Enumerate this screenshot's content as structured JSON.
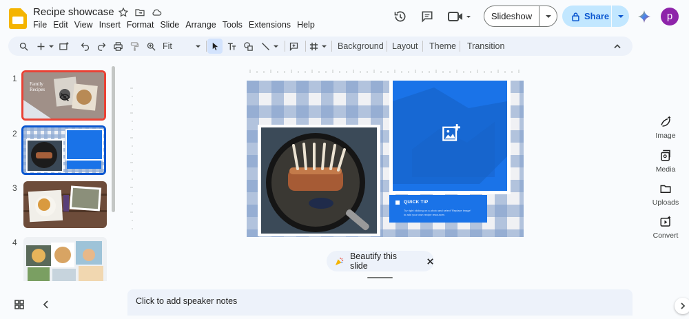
{
  "app": {
    "doc_title": "Recipe showcase",
    "user_initial": "p"
  },
  "menu": [
    "File",
    "Edit",
    "View",
    "Insert",
    "Format",
    "Slide",
    "Arrange",
    "Tools",
    "Extensions",
    "Help"
  ],
  "header": {
    "slideshow_label": "Slideshow",
    "share_label": "Share"
  },
  "toolbar": {
    "zoom_value": "Fit",
    "background_label": "Background",
    "layout_label": "Layout",
    "theme_label": "Theme",
    "transition_label": "Transition"
  },
  "slides": [
    {
      "number": "1",
      "title_line1": "Family",
      "title_line2": "Recipes"
    },
    {
      "number": "2"
    },
    {
      "number": "3"
    },
    {
      "number": "4"
    }
  ],
  "current_slide": {
    "tip_title": "QUICK TIP",
    "tip_body_line1": "Try right clicking on a photo and select 'Replace image'",
    "tip_body_line2": "to add your own recipe resources"
  },
  "beautify": {
    "label": "Beautify this slide"
  },
  "notes": {
    "placeholder": "Click to add speaker notes"
  },
  "side_panel": [
    {
      "label": "Image",
      "icon": "banana-image-icon"
    },
    {
      "label": "Media",
      "icon": "media-icon"
    },
    {
      "label": "Uploads",
      "icon": "folder-icon"
    },
    {
      "label": "Convert",
      "icon": "convert-video-icon"
    }
  ],
  "colors": {
    "accent_blue": "#0b57d0",
    "share_bg": "#c2e7ff",
    "selected_thumb": "#e94235",
    "tip_blue": "#1a73e8",
    "avatar": "#8e24aa"
  }
}
